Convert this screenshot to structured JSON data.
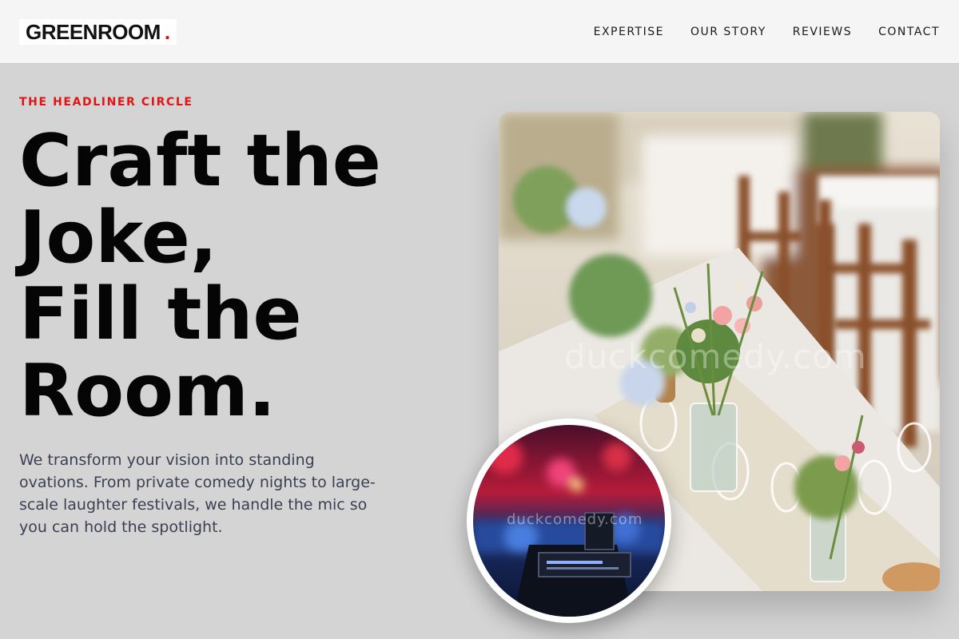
{
  "brand": {
    "name": "GREENROOM",
    "dot": ".",
    "accent": "#d90f0f"
  },
  "nav": {
    "items": [
      {
        "label": "EXPERTISE"
      },
      {
        "label": "OUR STORY"
      },
      {
        "label": "REVIEWS"
      },
      {
        "label": "CONTACT"
      }
    ]
  },
  "hero": {
    "eyebrow": "THE HEADLINER CIRCLE",
    "headline_lines": [
      "Craft the",
      "Joke,",
      "Fill the",
      "Room."
    ],
    "intro": "We transform your vision into standing ovations. From private comedy nights to large-scale laughter festivals, we handle the mic so you can hold the spotlight.",
    "main_image": {
      "icon": "banquet-table-photo",
      "watermark": "duckcomedy.com"
    },
    "inset_image": {
      "icon": "stage-mixer-photo",
      "watermark": "duckcomedy.com"
    }
  }
}
